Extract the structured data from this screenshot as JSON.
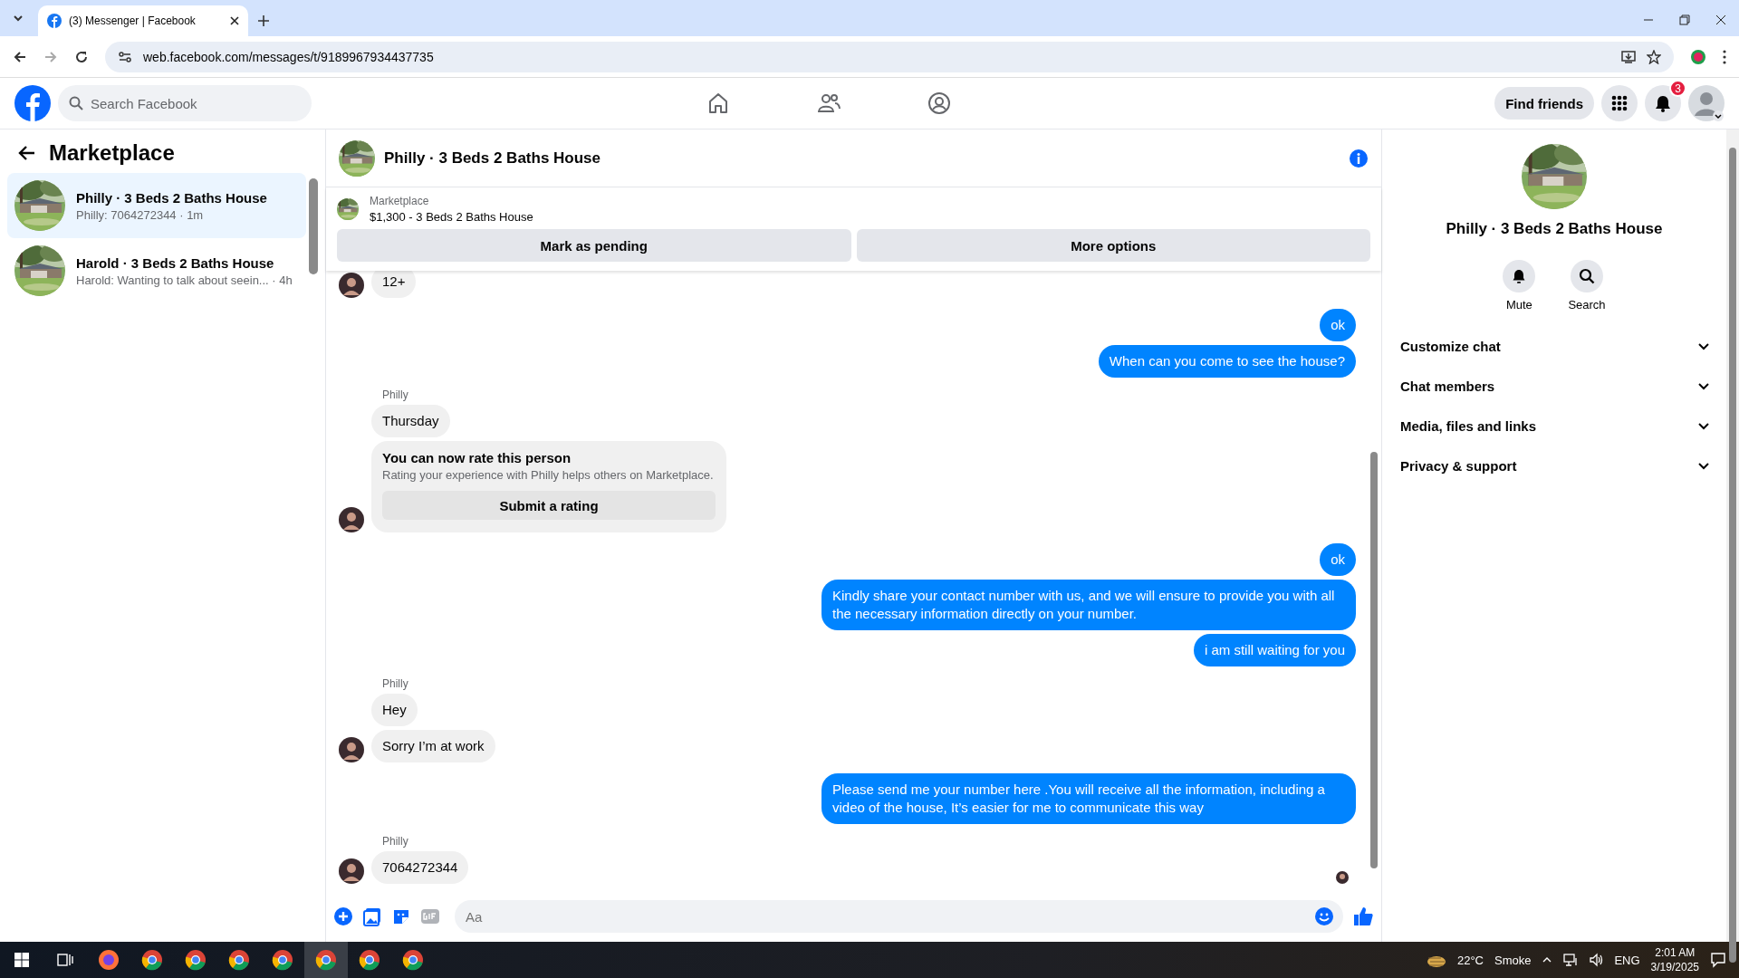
{
  "browser": {
    "tab_title": "(3) Messenger | Facebook",
    "url": "web.facebook.com/messages/t/9189967934437735"
  },
  "header": {
    "search_placeholder": "Search Facebook",
    "find_friends": "Find friends",
    "notification_count": "3"
  },
  "sidebar": {
    "title": "Marketplace",
    "conversations": [
      {
        "title": "Philly · 3 Beds 2 Baths House",
        "preview": "Philly: 7064272344 · 1m",
        "selected": true
      },
      {
        "title": "Harold · 3 Beds 2 Baths House",
        "preview": "Harold: Wanting to talk about seein... · 4h",
        "selected": false
      }
    ]
  },
  "chat": {
    "title": "Philly · 3 Beds 2 Baths House",
    "listing": {
      "label": "Marketplace",
      "title": "$1,300 - 3 Beds 2 Baths House"
    },
    "actions": [
      "Mark as pending",
      "More options"
    ],
    "messages": [
      {
        "kind": "incoming",
        "text": "12+",
        "avatar": true
      },
      {
        "kind": "outgoing",
        "text": "ok"
      },
      {
        "kind": "outgoing",
        "text": "When can you come to see the house?"
      },
      {
        "kind": "incoming",
        "sender": "Philly",
        "text": "Thursday",
        "avatar": false
      },
      {
        "kind": "rating",
        "title": "You can now rate this person",
        "text": "Rating your experience with Philly helps others on Marketplace.",
        "button": "Submit a rating",
        "avatar": true
      },
      {
        "kind": "outgoing",
        "text": "ok"
      },
      {
        "kind": "outgoing",
        "text": "Kindly share your contact number with us, and we will ensure to provide you with all the necessary information directly on your number."
      },
      {
        "kind": "outgoing",
        "text": "i am still waiting for you"
      },
      {
        "kind": "incoming",
        "sender": "Philly",
        "text": "Hey",
        "avatar": false
      },
      {
        "kind": "incoming",
        "text": "Sorry I’m at work",
        "avatar": true
      },
      {
        "kind": "outgoing",
        "text": "Please send me your number here .You will receive all the information, including a video of the house, It’s easier for me to communicate this way"
      },
      {
        "kind": "incoming",
        "sender": "Philly",
        "text": "7064272344",
        "avatar": true
      }
    ],
    "input_placeholder": "Aa"
  },
  "details": {
    "title": "Philly · 3 Beds 2 Baths House",
    "actions": [
      {
        "kind": "mute",
        "label": "Mute"
      },
      {
        "kind": "search",
        "label": "Search"
      }
    ],
    "sections": [
      {
        "label": "Customize chat",
        "expanded": false
      },
      {
        "label": "Chat members",
        "expanded": false
      },
      {
        "label": "Media, files and links",
        "expanded": false
      },
      {
        "label": "Privacy & support",
        "expanded": false
      }
    ]
  },
  "taskbar": {
    "temperature": "22°C",
    "weather": "Smoke",
    "language": "ENG",
    "time": "2:01 AM",
    "date": "3/19/2025"
  }
}
